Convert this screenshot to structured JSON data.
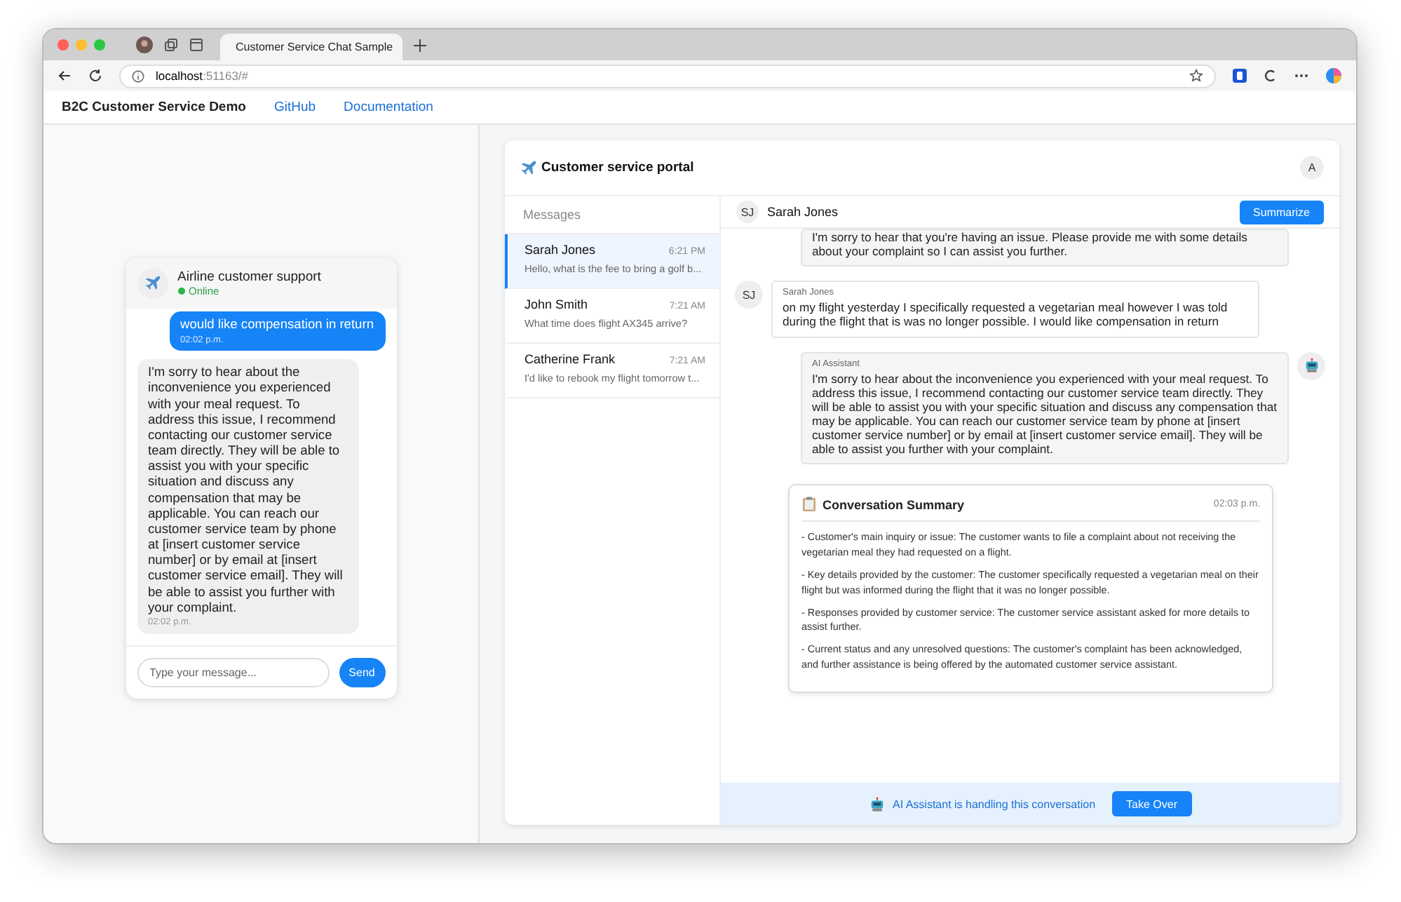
{
  "browser": {
    "tab_title": "Customer Service Chat Sample",
    "url_host": "localhost",
    "url_rest": ":51163/#"
  },
  "nav": {
    "brand": "B2C Customer Service Demo",
    "links": [
      "GitHub",
      "Documentation"
    ]
  },
  "widget": {
    "title": "Airline customer support",
    "status": "Online",
    "online": true,
    "messages": [
      {
        "kind": "user",
        "text": "would like compensation in return",
        "time": "02:02 p.m."
      },
      {
        "kind": "bot",
        "text": "I'm sorry to hear about the inconvenience you experienced with your meal request. To address this issue, I recommend contacting our customer service team directly. They will be able to assist you with your specific situation and discuss any compensation that may be applicable. You can reach our customer service team by phone at [insert customer service number] or by email at [insert customer service email]. They will be able to assist you further with your complaint.",
        "time": "02:02 p.m."
      }
    ],
    "placeholder": "Type your message...",
    "send": "Send"
  },
  "portal": {
    "title": "Customer service portal",
    "avatar": "A",
    "sidebar_title": "Messages",
    "conversations": [
      {
        "name": "Sarah Jones",
        "time": "6:21 PM",
        "preview": "Hello, what is the fee to bring a golf b...",
        "selected": true
      },
      {
        "name": "John Smith",
        "time": "7:21 AM",
        "preview": "What time does flight AX345 arrive?",
        "selected": false
      },
      {
        "name": "Catherine Frank",
        "time": "7:21 AM",
        "preview": "I'd like to rebook my flight tomorrow t...",
        "selected": false
      }
    ],
    "chat": {
      "initials": "SJ",
      "name": "Sarah Jones",
      "summarize": "Summarize",
      "messages": [
        {
          "kind": "agent",
          "text": "I'm sorry to hear that you're having an issue. Please provide me with some details about your complaint so I can assist you further."
        },
        {
          "kind": "customer",
          "initials": "SJ",
          "sender": "Sarah Jones",
          "text": "on my flight yesterday I specifically requested a vegetarian meal however I was told during the flight that is was no longer possible. I would like compensation in return"
        },
        {
          "kind": "ai",
          "sender": "AI Assistant",
          "text": "I'm sorry to hear about the inconvenience you experienced with your meal request. To address this issue, I recommend contacting our customer service team directly. They will be able to assist you with your specific situation and discuss any compensation that may be applicable. You can reach our customer service team by phone at [insert customer service number] or by email at [insert customer service email]. They will be able to assist you further with your complaint."
        }
      ],
      "summary": {
        "title": "Conversation Summary",
        "time": "02:03 p.m.",
        "items": [
          "- Customer's main inquiry or issue: The customer wants to file a complaint about not receiving the vegetarian meal they had requested on a flight.",
          "- Key details provided by the customer: The customer specifically requested a vegetarian meal on their flight but was informed during the flight that it was no longer possible.",
          "- Responses provided by customer service: The customer service assistant asked for more details to assist further.",
          "- Current status and any unresolved questions: The customer's complaint has been acknowledged, and further assistance is being offered by the automated customer service assistant."
        ]
      },
      "banner": {
        "text": "AI Assistant is handling this conversation",
        "button": "Take Over"
      }
    }
  }
}
